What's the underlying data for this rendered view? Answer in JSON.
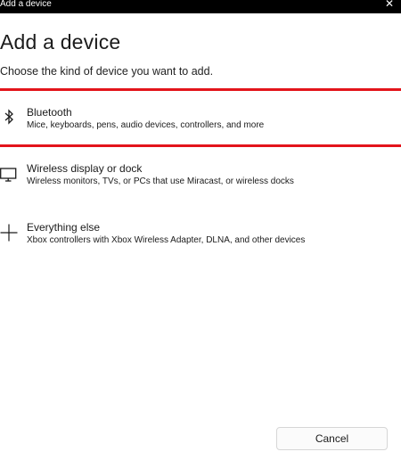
{
  "window": {
    "title": "Add a device",
    "close_glyph": "✕"
  },
  "page": {
    "heading": "Add a device",
    "subtitle": "Choose the kind of device you want to add."
  },
  "options": [
    {
      "icon": "bluetooth-icon",
      "name": "Bluetooth",
      "description": "Mice, keyboards, pens, audio devices, controllers, and more",
      "highlighted": true
    },
    {
      "icon": "monitor-icon",
      "name": "Wireless display or dock",
      "description": "Wireless monitors, TVs, or PCs that use Miracast, or wireless docks",
      "highlighted": false
    },
    {
      "icon": "plus-icon",
      "name": "Everything else",
      "description": "Xbox controllers with Xbox Wireless Adapter, DLNA, and other devices",
      "highlighted": false
    }
  ],
  "footer": {
    "cancel_label": "Cancel"
  },
  "colors": {
    "highlight": "#e3141b",
    "titlebar": "#000000"
  }
}
